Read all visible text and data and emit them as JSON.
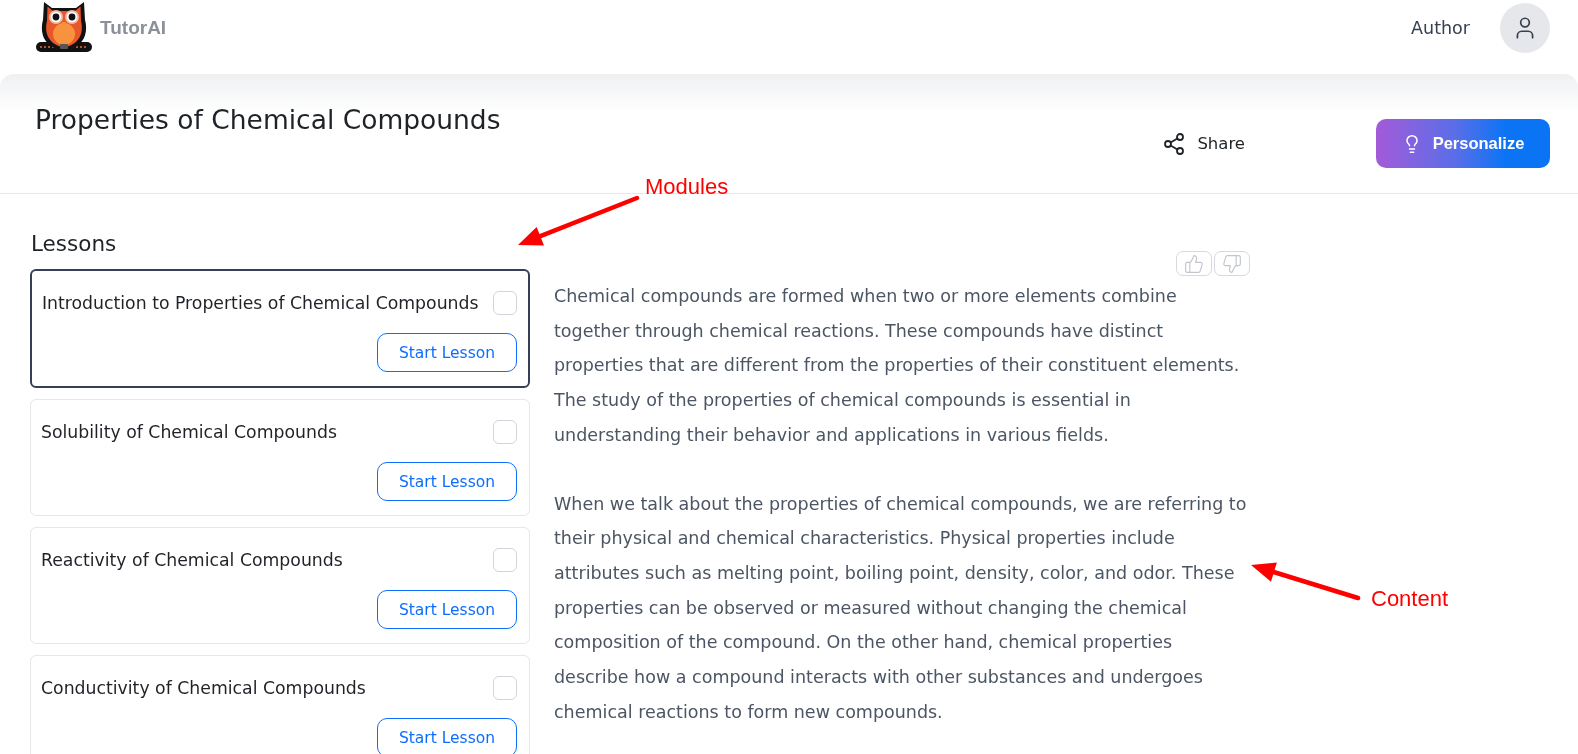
{
  "header": {
    "brand": "TutorAI",
    "user_label": "Author"
  },
  "page": {
    "title": "Properties of Chemical Compounds",
    "actions": [
      {
        "kind": "share",
        "label": "Share"
      },
      {
        "kind": "personalize",
        "label": "Personalize"
      }
    ]
  },
  "lessons": {
    "heading": "Lessons",
    "items": [
      {
        "title": "Introduction to Properties of Chemical Compounds",
        "selected": true,
        "checked": false,
        "action": "Start Lesson"
      },
      {
        "title": "Solubility of Chemical Compounds",
        "selected": false,
        "checked": false,
        "action": "Start Lesson"
      },
      {
        "title": "Reactivity of Chemical Compounds",
        "selected": false,
        "checked": false,
        "action": "Start Lesson"
      },
      {
        "title": "Conductivity of Chemical Compounds",
        "selected": false,
        "checked": false,
        "action": "Start Lesson"
      }
    ]
  },
  "content": {
    "paragraphs": [
      "Chemical compounds are formed when two or more elements combine together through chemical reactions. These compounds have distinct properties that are different from the properties of their constituent elements. The study of the properties of chemical compounds is essential in understanding their behavior and applications in various fields.",
      "When we talk about the properties of chemical compounds, we are referring to their physical and chemical characteristics. Physical properties include attributes such as melting point, boiling point, density, color, and odor. These properties can be observed or measured without changing the chemical composition of the compound. On the other hand, chemical properties describe how a compound interacts with other substances and undergoes chemical reactions to form new compounds."
    ]
  },
  "annotations": [
    {
      "label": "Modules"
    },
    {
      "label": "Content"
    }
  ]
}
